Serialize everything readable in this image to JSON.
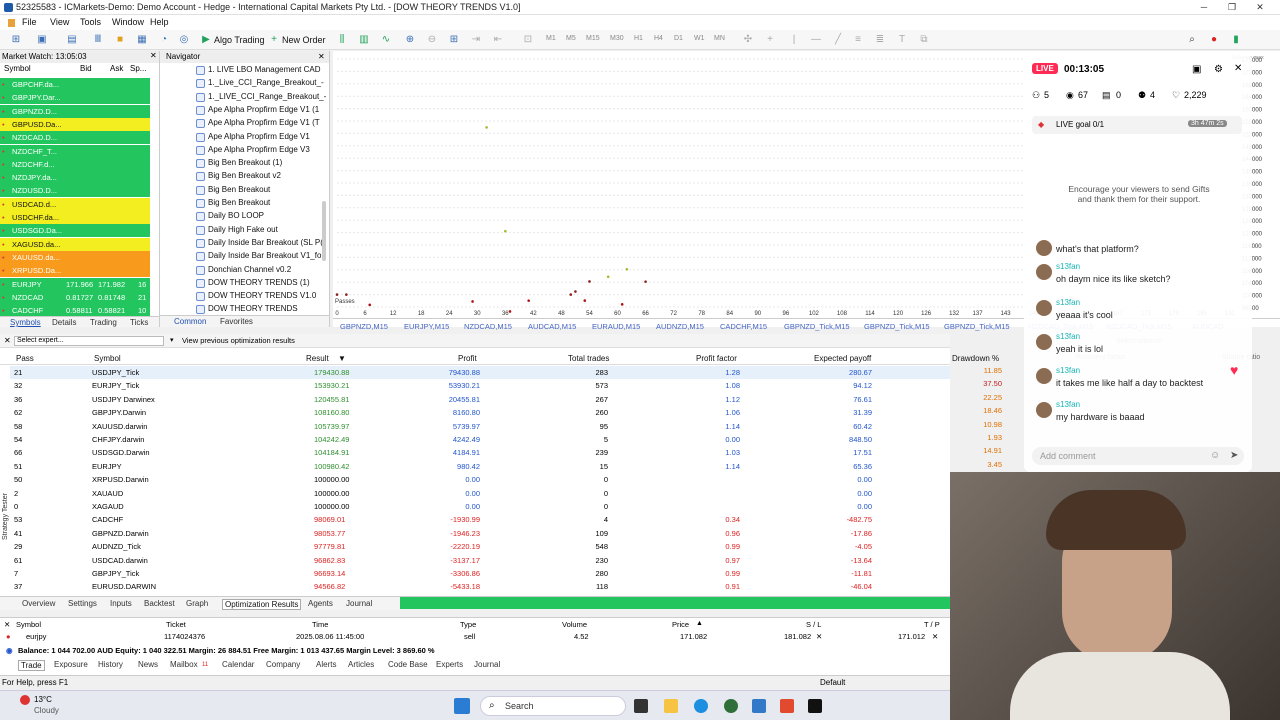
{
  "window": {
    "title": "52325583 - ICMarkets-Demo: Demo Account - Hedge - International Capital Markets Pty Ltd. - [DOW THEORY TRENDS V1.0]",
    "minimize": "─",
    "maximize": "❐",
    "close": "✕"
  },
  "menu": [
    "File",
    "View",
    "Tools",
    "Window",
    "Help"
  ],
  "toolbar": {
    "algo_trading": "Algo Trading",
    "new_order": "New Order",
    "timeframes": [
      "M1",
      "M5",
      "M15",
      "M30",
      "H1",
      "H4",
      "D1",
      "W1",
      "MN"
    ]
  },
  "market_watch": {
    "title": "Market Watch: 13:05:03",
    "headers": [
      "Symbol",
      "Bid",
      "Ask",
      "Sp..."
    ],
    "rows": [
      {
        "symbol": "GBPCHF.da...",
        "bid": "",
        "ask": "",
        "spread": "",
        "color": "green"
      },
      {
        "symbol": "GBPJPY.Dar...",
        "bid": "",
        "ask": "",
        "spread": "",
        "color": "green"
      },
      {
        "symbol": "GBPNZD.D...",
        "bid": "",
        "ask": "",
        "spread": "",
        "color": "green"
      },
      {
        "symbol": "GBPUSD.Da...",
        "bid": "",
        "ask": "",
        "spread": "",
        "color": "yellow"
      },
      {
        "symbol": "NZDCAD.D...",
        "bid": "",
        "ask": "",
        "spread": "",
        "color": "green"
      },
      {
        "symbol": "NZDCHF_T...",
        "bid": "",
        "ask": "",
        "spread": "",
        "color": "green"
      },
      {
        "symbol": "NZDCHF.d...",
        "bid": "",
        "ask": "",
        "spread": "",
        "color": "green"
      },
      {
        "symbol": "NZDJPY.da...",
        "bid": "",
        "ask": "",
        "spread": "",
        "color": "green"
      },
      {
        "symbol": "NZDUSD.D...",
        "bid": "",
        "ask": "",
        "spread": "",
        "color": "green"
      },
      {
        "symbol": "USDCAD.d...",
        "bid": "",
        "ask": "",
        "spread": "",
        "color": "yellow"
      },
      {
        "symbol": "USDCHF.da...",
        "bid": "",
        "ask": "",
        "spread": "",
        "color": "yellow"
      },
      {
        "symbol": "USDSGD.Da...",
        "bid": "",
        "ask": "",
        "spread": "",
        "color": "green"
      },
      {
        "symbol": "XAGUSD.da...",
        "bid": "",
        "ask": "",
        "spread": "",
        "color": "yellow"
      },
      {
        "symbol": "XAUUSD.da...",
        "bid": "",
        "ask": "",
        "spread": "",
        "color": "orange"
      },
      {
        "symbol": "XRPUSD.Da...",
        "bid": "",
        "ask": "",
        "spread": "",
        "color": "orange"
      },
      {
        "symbol": "EURJPY",
        "bid": "171.966",
        "ask": "171.982",
        "spread": "16",
        "color": "green"
      },
      {
        "symbol": "NZDCAD",
        "bid": "0.81727",
        "ask": "0.81748",
        "spread": "21",
        "color": "green"
      },
      {
        "symbol": "CADCHF",
        "bid": "0.58811",
        "ask": "0.58821",
        "spread": "10",
        "color": "green"
      }
    ],
    "tabs": [
      "Symbols",
      "Details",
      "Trading",
      "Ticks"
    ]
  },
  "navigator": {
    "title": "Navigator",
    "items": [
      "1. LIVE LBO Management CAD",
      "1._Live_CCI_Range_Breakout_-",
      "1._LIVE_CCI_Range_Breakout_-",
      "Ape Alpha Propfirm Edge V1 (1",
      "Ape Alpha Propfirm Edge V1 (T",
      "Ape Alpha Propfirm Edge V1",
      "Ape Alpha Propfirm Edge V3",
      "Big Ben Breakout (1)",
      "Big Ben Breakout v2",
      "Big Ben Breakout",
      "Big Ben Breakout",
      "Daily BO LOOP",
      "Daily High Fake out",
      "Daily Inside Bar Breakout (SL P(",
      "Daily Inside Bar Breakout V1_fo",
      "Donchian Channel v0.2",
      "DOW THEORY TRENDS (1)",
      "DOW THEORY TRENDS V1.0",
      "DOW THEORY TRENDS"
    ],
    "tabs": [
      "Common",
      "Favorites"
    ]
  },
  "chart": {
    "x_ticks": [
      "0",
      "6",
      "12",
      "18",
      "24",
      "30",
      "36",
      "42",
      "48",
      "54",
      "60",
      "66",
      "72",
      "78",
      "84",
      "90",
      "96",
      "102",
      "108",
      "114",
      "120",
      "126",
      "132",
      "137",
      "143",
      "149",
      "155",
      "161",
      "167",
      "173",
      "179",
      "185",
      "191"
    ],
    "y_ticks": [
      "176000",
      "172000",
      "168000",
      "164000",
      "160000",
      "156000",
      "152000",
      "148000",
      "144000",
      "140000",
      "136000",
      "132000",
      "128000",
      "124000",
      "120000",
      "116000",
      "112000",
      "108000",
      "104000",
      "100000",
      "96000"
    ],
    "label_passes": "Passes",
    "label_balance": "Balance max",
    "tabs": [
      "GBPNZD,M15",
      "EURJPY,M15",
      "NZDCAD,M15",
      "AUDCAD,M15",
      "EURAUD,M15",
      "AUDNZD,M15",
      "CADCHF,M15",
      "GBPNZD_Tick,M15",
      "GBPNZD_Tick,M15",
      "GBPNZD_Tick,M15",
      "NZDCAD_Tick,M15",
      "NZDCAD_Tick,M15",
      "AUDCAD"
    ],
    "select_criterion": "Select criterion",
    "recovery_factor": "Recovery factor",
    "sharpe_ratio": "Sharpe ratio"
  },
  "results": {
    "select_expert": "Select expert...",
    "use_previous": "View previous optimization results",
    "headers": [
      "Pass",
      "Symbol",
      "Result",
      "Profit",
      "Total trades",
      "Profit factor",
      "Expected payoff",
      "Drawdown %"
    ],
    "rows": [
      {
        "pass": "21",
        "symbol": "USDJPY_Tick",
        "result": "179430.88",
        "profit": "79430.88",
        "trades": "283",
        "pf": "1.28",
        "ep": "280.67",
        "dd": "11.85",
        "sign": "pos"
      },
      {
        "pass": "32",
        "symbol": "EURJPY_Tick",
        "result": "153930.21",
        "profit": "53930.21",
        "trades": "573",
        "pf": "1.08",
        "ep": "94.12",
        "dd": "37.50",
        "sign": "pos"
      },
      {
        "pass": "36",
        "symbol": "USDJPY Darwinex",
        "result": "120455.81",
        "profit": "20455.81",
        "trades": "267",
        "pf": "1.12",
        "ep": "76.61",
        "dd": "22.25",
        "sign": "pos"
      },
      {
        "pass": "62",
        "symbol": "GBPJPY.Darwin",
        "result": "108160.80",
        "profit": "8160.80",
        "trades": "260",
        "pf": "1.06",
        "ep": "31.39",
        "dd": "18.46",
        "sign": "pos"
      },
      {
        "pass": "58",
        "symbol": "XAUUSD.darwin",
        "result": "105739.97",
        "profit": "5739.97",
        "trades": "95",
        "pf": "1.14",
        "ep": "60.42",
        "dd": "10.98",
        "sign": "pos"
      },
      {
        "pass": "54",
        "symbol": "CHFJPY.darwin",
        "result": "104242.49",
        "profit": "4242.49",
        "trades": "5",
        "pf": "0.00",
        "ep": "848.50",
        "dd": "1.93",
        "sign": "pos"
      },
      {
        "pass": "66",
        "symbol": "USDSGD.Darwin",
        "result": "104184.91",
        "profit": "4184.91",
        "trades": "239",
        "pf": "1.03",
        "ep": "17.51",
        "dd": "14.91",
        "sign": "pos"
      },
      {
        "pass": "51",
        "symbol": "EURJPY",
        "result": "100980.42",
        "profit": "980.42",
        "trades": "15",
        "pf": "1.14",
        "ep": "65.36",
        "dd": "3.45",
        "sign": "pos"
      },
      {
        "pass": "50",
        "symbol": "XRPUSD.Darwin",
        "result": "100000.00",
        "profit": "0.00",
        "trades": "0",
        "pf": "",
        "ep": "0.00",
        "dd": "",
        "sign": "zero"
      },
      {
        "pass": "2",
        "symbol": "XAUAUD",
        "result": "100000.00",
        "profit": "0.00",
        "trades": "0",
        "pf": "",
        "ep": "0.00",
        "dd": "",
        "sign": "zero"
      },
      {
        "pass": "0",
        "symbol": "XAGAUD",
        "result": "100000.00",
        "profit": "0.00",
        "trades": "0",
        "pf": "",
        "ep": "0.00",
        "dd": "",
        "sign": "zero"
      },
      {
        "pass": "53",
        "symbol": "CADCHF",
        "result": "98069.01",
        "profit": "-1930.99",
        "trades": "4",
        "pf": "0.34",
        "ep": "-482.75",
        "dd": "",
        "sign": "neg"
      },
      {
        "pass": "41",
        "symbol": "GBPNZD.Darwin",
        "result": "98053.77",
        "profit": "-1946.23",
        "trades": "109",
        "pf": "0.96",
        "ep": "-17.86",
        "dd": "",
        "sign": "neg"
      },
      {
        "pass": "29",
        "symbol": "AUDNZD_Tick",
        "result": "97779.81",
        "profit": "-2220.19",
        "trades": "548",
        "pf": "0.99",
        "ep": "-4.05",
        "dd": "",
        "sign": "neg"
      },
      {
        "pass": "61",
        "symbol": "USDCAD.darwin",
        "result": "96862.83",
        "profit": "-3137.17",
        "trades": "230",
        "pf": "0.97",
        "ep": "-13.64",
        "dd": "",
        "sign": "neg"
      },
      {
        "pass": "7",
        "symbol": "GBPJPY_Tick",
        "result": "96693.14",
        "profit": "-3306.86",
        "trades": "280",
        "pf": "0.99",
        "ep": "-11.81",
        "dd": "",
        "sign": "neg"
      },
      {
        "pass": "37",
        "symbol": "EURUSD.DARWIN",
        "result": "94566.82",
        "profit": "-5433.18",
        "trades": "118",
        "pf": "0.91",
        "ep": "-46.04",
        "dd": "",
        "sign": "neg"
      }
    ],
    "tabs": [
      "Overview",
      "Settings",
      "Inputs",
      "Backtest",
      "Graph",
      "Optimization Results",
      "Agents",
      "Journal"
    ],
    "side_label": "Strategy Tester"
  },
  "trade": {
    "headers": [
      "Symbol",
      "Ticket",
      "Time",
      "Type",
      "Volume",
      "Price",
      "S / L",
      "T / P"
    ],
    "row": {
      "symbol": "eurjpy",
      "ticket": "1174024376",
      "time": "2025.08.06 11:45:00",
      "type": "sell",
      "volume": "4.52",
      "price": "171.082",
      "sl": "181.082",
      "tp": "171.012"
    },
    "balance": "Balance: 1 044 702.00 AUD  Equity: 1 040 322.51  Margin: 26 884.51  Free Margin: 1 013 437.65  Margin Level: 3 869.60 %",
    "tabs": [
      "Trade",
      "Exposure",
      "History",
      "News",
      "Mailbox",
      "Calendar",
      "Company",
      "Alerts",
      "Articles",
      "Code Base",
      "Experts",
      "Journal"
    ],
    "mailbox_count": "11"
  },
  "status": {
    "help": "For Help, press F1",
    "profile": "Default"
  },
  "taskbar": {
    "temp": "13°C",
    "weather": "Cloudy",
    "search": "Search"
  },
  "stream": {
    "live": "LIVE",
    "timer": "00:13:05",
    "stats": [
      "5",
      "67",
      "0",
      "4",
      "2,229"
    ],
    "goal": "LIVE goal 0/1",
    "goal_time": "3h 47m 2s",
    "encourage": "Encourage your viewers to send Gifts and thank them for their support.",
    "chat": [
      {
        "name": "",
        "msg": "what's that platform?"
      },
      {
        "name": "s13fan",
        "msg": "oh daym nice its like sketch?"
      },
      {
        "name": "s13fan",
        "msg": "yeaaa it's cool"
      },
      {
        "name": "s13fan",
        "msg": "yeah it is lol"
      },
      {
        "name": "s13fan",
        "msg": "it takes me like half a day to backtest"
      },
      {
        "name": "s13fan",
        "msg": "my hardware is baaad"
      }
    ],
    "comment_placeholder": "Add comment"
  }
}
